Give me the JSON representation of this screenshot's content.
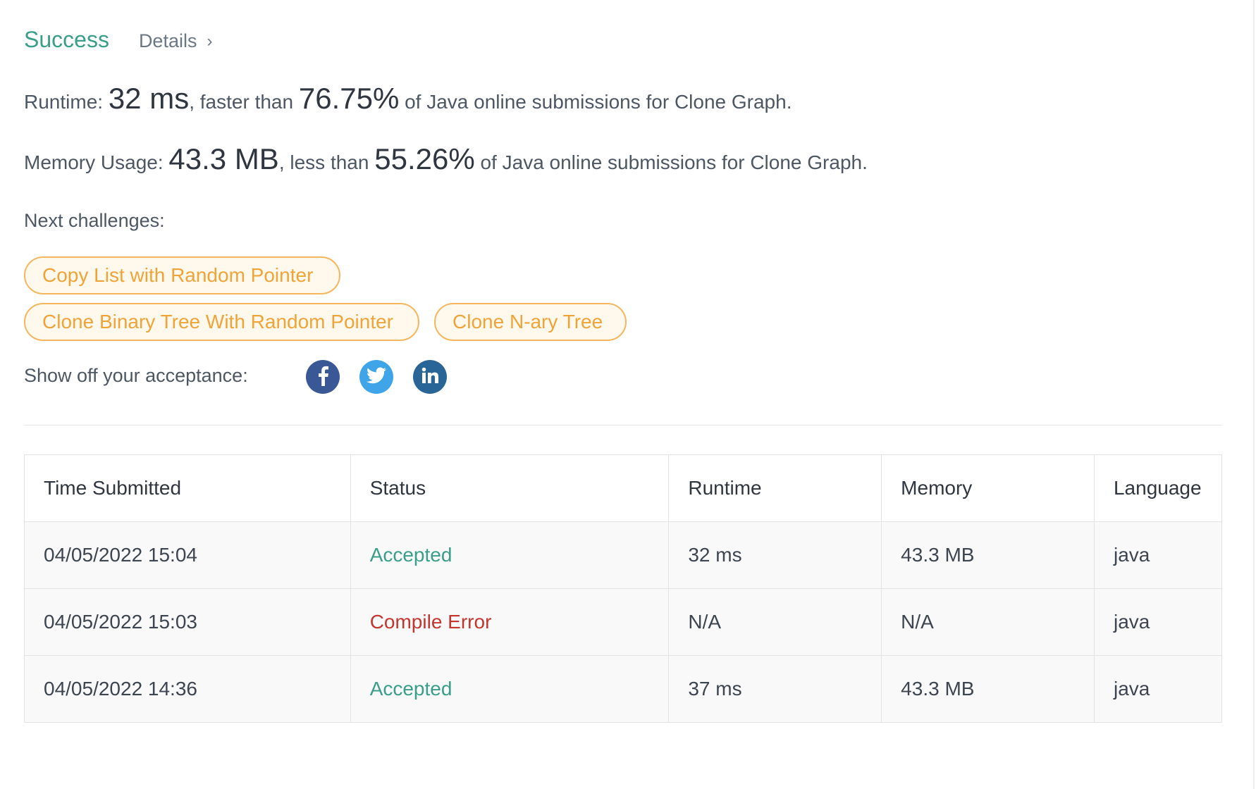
{
  "result": {
    "status": "Success",
    "details_label": "Details",
    "details_chevron": "›"
  },
  "runtime": {
    "label": "Runtime:",
    "value": "32 ms",
    "comparison_prefix": ", faster than",
    "percent": "76.75%",
    "suffix": "of Java online submissions for Clone Graph."
  },
  "memory": {
    "label": "Memory Usage:",
    "value": "43.3 MB",
    "comparison_prefix": ", less than",
    "percent": "55.26%",
    "suffix": "of Java online submissions for Clone Graph."
  },
  "next_challenges": {
    "label": "Next challenges:",
    "items": [
      "Copy List with Random Pointer",
      "Clone Binary Tree With Random Pointer",
      "Clone N-ary Tree"
    ]
  },
  "share": {
    "label": "Show off your acceptance:",
    "icons": [
      "facebook-icon",
      "twitter-icon",
      "linkedin-icon"
    ],
    "colors": {
      "facebook": "#3b5896",
      "twitter": "#3fa4e8",
      "linkedin": "#2a6598"
    }
  },
  "submissions": {
    "columns": [
      "Time Submitted",
      "Status",
      "Runtime",
      "Memory",
      "Language"
    ],
    "rows": [
      {
        "time": "04/05/2022 15:04",
        "status": "Accepted",
        "runtime": "32 ms",
        "memory": "43.3 MB",
        "language": "java"
      },
      {
        "time": "04/05/2022 15:03",
        "status": "Compile Error",
        "runtime": "N/A",
        "memory": "N/A",
        "language": "java"
      },
      {
        "time": "04/05/2022 14:36",
        "status": "Accepted",
        "runtime": "37 ms",
        "memory": "43.3 MB",
        "language": "java"
      }
    ]
  },
  "colors": {
    "success": "#3a9e8a",
    "error": "#c2362f",
    "chip_border": "#f5b65e",
    "chip_text": "#f0a438"
  }
}
